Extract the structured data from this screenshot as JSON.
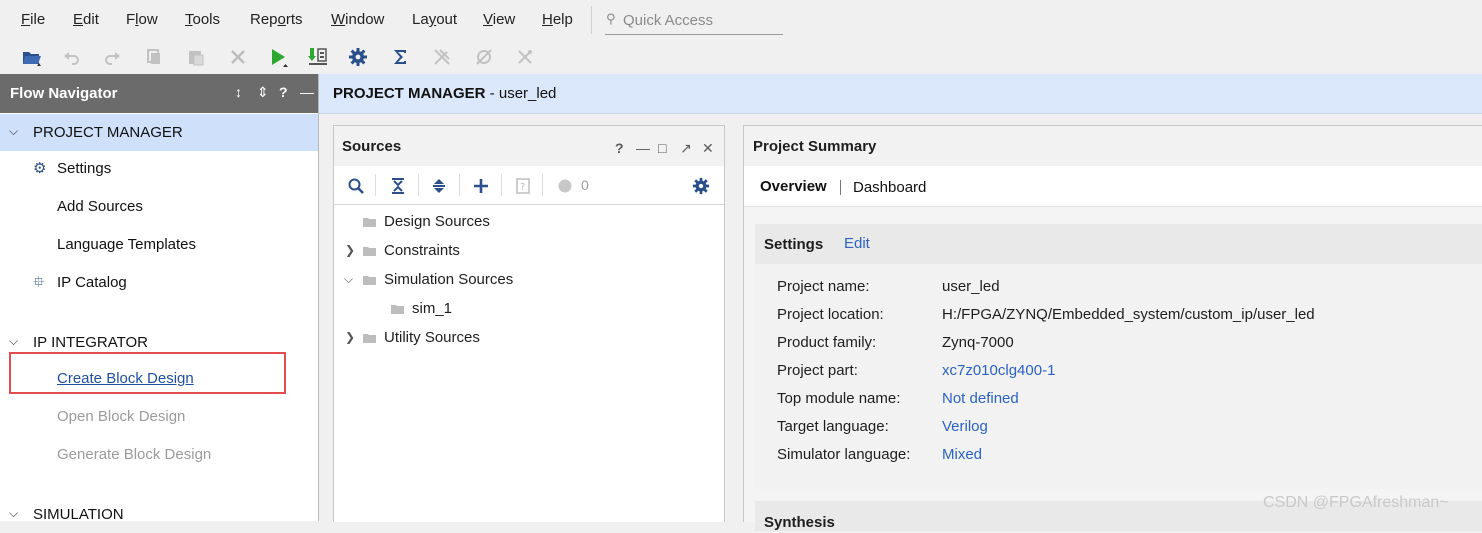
{
  "menu": {
    "items": [
      {
        "pre": "",
        "u": "F",
        "post": "ile"
      },
      {
        "pre": "",
        "u": "E",
        "post": "dit"
      },
      {
        "pre": "F",
        "u": "l",
        "post": "ow"
      },
      {
        "pre": "",
        "u": "T",
        "post": "ools"
      },
      {
        "pre": "Rep",
        "u": "o",
        "post": "rts"
      },
      {
        "pre": "",
        "u": "W",
        "post": "indow"
      },
      {
        "pre": "La",
        "u": "y",
        "post": "out"
      },
      {
        "pre": "",
        "u": "V",
        "post": "iew"
      },
      {
        "pre": "",
        "u": "H",
        "post": "elp"
      }
    ],
    "quick_access_placeholder": "Quick Access"
  },
  "toolbar": {
    "icons": [
      "open-project-icon",
      "undo-icon",
      "redo-icon",
      "copy-icon",
      "paste-icon",
      "delete-icon",
      "run-icon",
      "program-device-icon",
      "settings-icon",
      "sigma-icon",
      "disabled-tool-1-icon",
      "disabled-tool-2-icon",
      "disabled-tool-3-icon"
    ]
  },
  "flow_navigator": {
    "title": "Flow Navigator",
    "project_manager": {
      "label": "PROJECT MANAGER",
      "items": [
        "Settings",
        "Add Sources",
        "Language Templates",
        "IP Catalog"
      ]
    },
    "ip_integrator": {
      "label": "IP INTEGRATOR",
      "items": [
        "Create Block Design",
        "Open Block Design",
        "Generate Block Design"
      ]
    },
    "simulation": {
      "label": "SIMULATION"
    }
  },
  "main_header": {
    "title": "PROJECT MANAGER",
    "suffix": " - user_led"
  },
  "sources": {
    "title": "Sources",
    "count": "0",
    "tree": [
      "Design Sources",
      "Constraints",
      "Simulation Sources",
      "sim_1",
      "Utility Sources"
    ]
  },
  "summary": {
    "title": "Project Summary",
    "tabs": {
      "overview": "Overview",
      "dashboard": "Dashboard"
    },
    "settings": {
      "title": "Settings",
      "edit": "Edit",
      "rows": [
        {
          "label": "Project name:",
          "value": "user_led"
        },
        {
          "label": "Project location:",
          "value": "H:/FPGA/ZYNQ/Embedded_system/custom_ip/user_led"
        },
        {
          "label": "Product family:",
          "value": "Zynq-7000"
        },
        {
          "label": "Project part:",
          "value": "xc7z010clg400-1"
        },
        {
          "label": "Top module name:",
          "value": "Not defined"
        },
        {
          "label": "Target language:",
          "value": "Verilog"
        },
        {
          "label": "Simulator language:",
          "value": "Mixed"
        }
      ]
    },
    "synthesis_title": "Synthesis"
  },
  "watermark": "CSDN @FPGAfreshman~",
  "colors": {
    "accent_link": "#2b62c4",
    "header_blue": "#dbe8fb",
    "nav_header": "#6b6b6b",
    "run_green": "#2ea832",
    "highlight_red": "#e24c4c"
  }
}
